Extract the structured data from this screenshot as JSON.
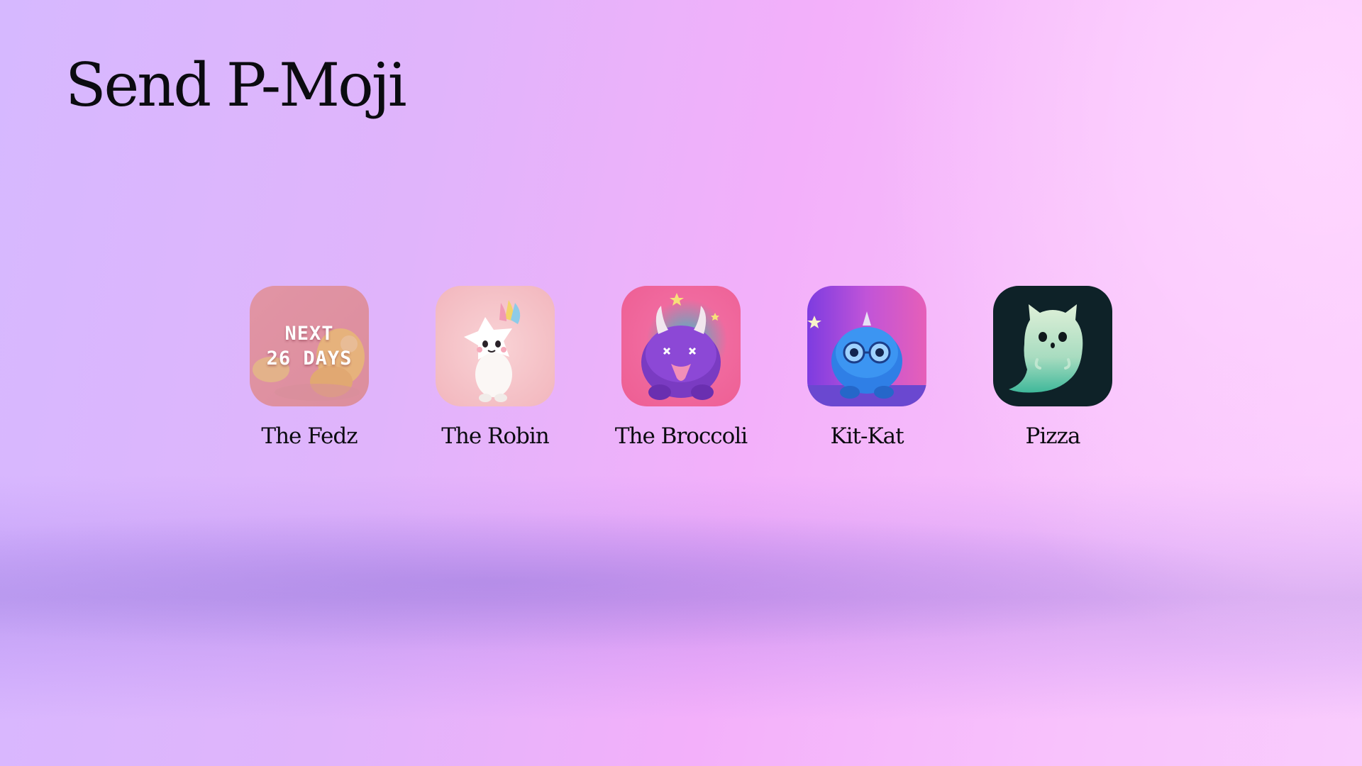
{
  "page": {
    "title": "Send P-Moji"
  },
  "mojis": [
    {
      "name": "The Fedz",
      "icon": "yellow-chick-icon",
      "locked": true,
      "lock_line1": "NEXT",
      "lock_line2": "26 DAYS"
    },
    {
      "name": "The Robin",
      "icon": "white-star-creature-icon",
      "locked": false
    },
    {
      "name": "The Broccoli",
      "icon": "purple-monster-icon",
      "locked": false
    },
    {
      "name": "Kit-Kat",
      "icon": "blue-glasses-creature-icon",
      "locked": false
    },
    {
      "name": "Pizza",
      "icon": "green-ghost-cat-icon",
      "locked": false
    }
  ],
  "colors": {
    "title_text": "#0b0b10",
    "background_left": "#d6b8ff",
    "background_right": "#f9ccfd",
    "lock_text": "#ffffff"
  }
}
